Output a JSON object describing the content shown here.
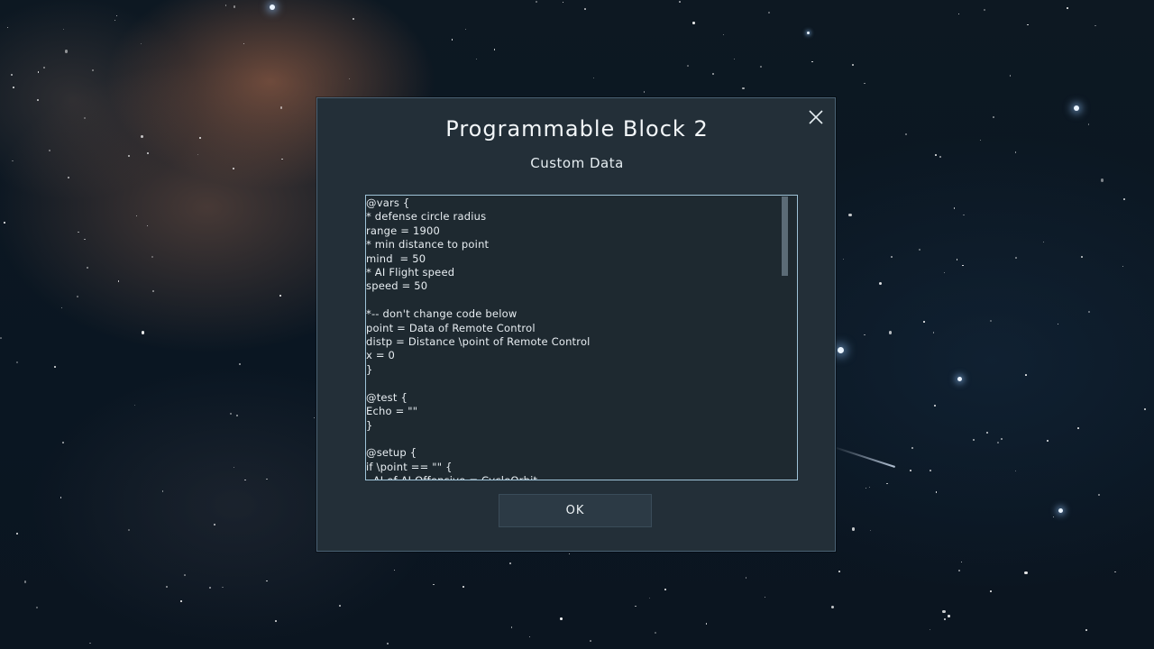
{
  "dialog": {
    "title": "Programmable Block 2",
    "subtitle": "Custom Data",
    "close_icon": "close-icon",
    "ok_label": "OK"
  },
  "custom_data": {
    "text": "@vars {\n* defense circle radius\nrange = 1900\n* min distance to point\nmind  = 50\n* AI Flight speed\nspeed = 50\n\n*-- don't change code below\npoint = Data of Remote Control\ndistp = Distance \\point of Remote Control\nx = 0\n}\n\n@test {\nEcho = \"\"\n}\n\n@setup {\nif \\point == \"\" {\n  AI of AI Offensive = CycleOrbit"
  },
  "colors": {
    "dialog_bg": "#232f38",
    "dialog_border": "#4a6275",
    "editor_border": "#9fc3d8",
    "text": "#e8eef2",
    "button_bg": "#2c3a45"
  }
}
